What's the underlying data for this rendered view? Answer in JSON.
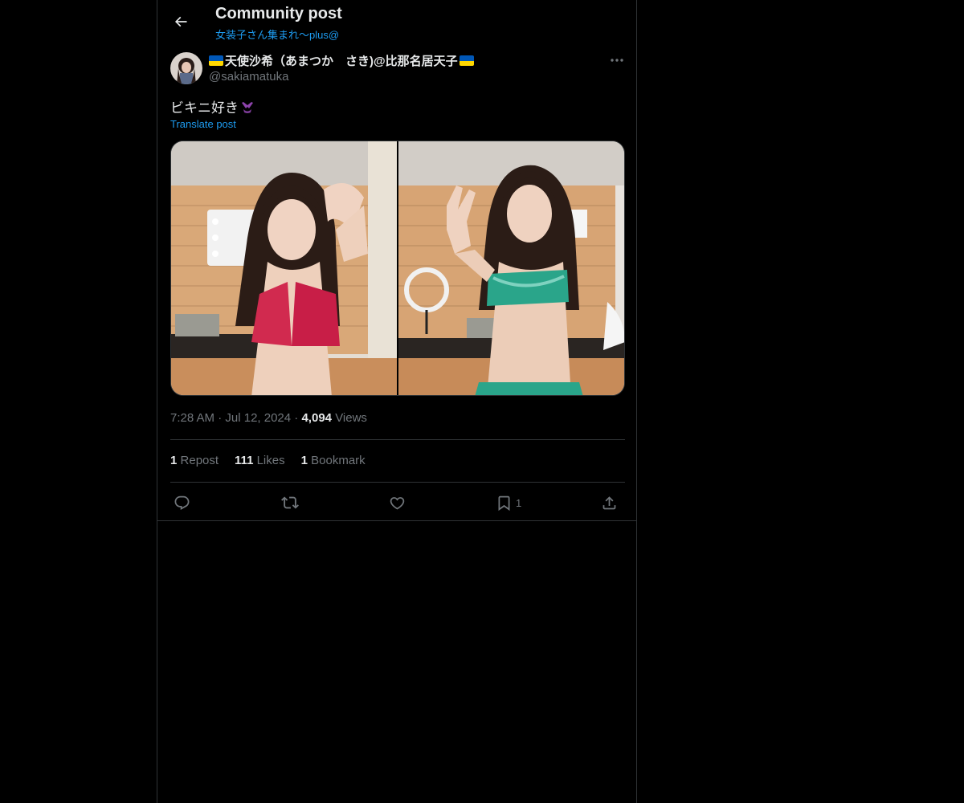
{
  "header": {
    "title": "Community post",
    "community": "女装子さん集まれ〜plus@"
  },
  "post": {
    "author_name": "天使沙希（あまつか　さき)@比那名居天子",
    "author_handle": "@sakiamatuka",
    "text": "ビキニ好き",
    "translate_label": "Translate post",
    "time": "7:28 AM",
    "date": "Jul 12, 2024",
    "views_count": "4,094",
    "views_label": "Views",
    "separator": "·"
  },
  "stats": {
    "reposts_count": "1",
    "reposts_label": "Repost",
    "likes_count": "111",
    "likes_label": "Likes",
    "bookmarks_count": "1",
    "bookmarks_label": "Bookmark"
  },
  "actions": {
    "bookmark_count": "1"
  },
  "icons": {
    "back": "arrow-left-icon",
    "more": "more-horizontal-icon",
    "reply": "reply-icon",
    "repost": "repost-icon",
    "like": "heart-icon",
    "bookmark": "bookmark-icon",
    "share": "share-icon",
    "flag": "ukraine-flag-icon",
    "emoji": "bikini-emoji-icon"
  },
  "colors": {
    "background": "#000000",
    "text": "#e7e9ea",
    "muted": "#71767b",
    "accent": "#1d9bf0",
    "border": "#2f3336"
  }
}
